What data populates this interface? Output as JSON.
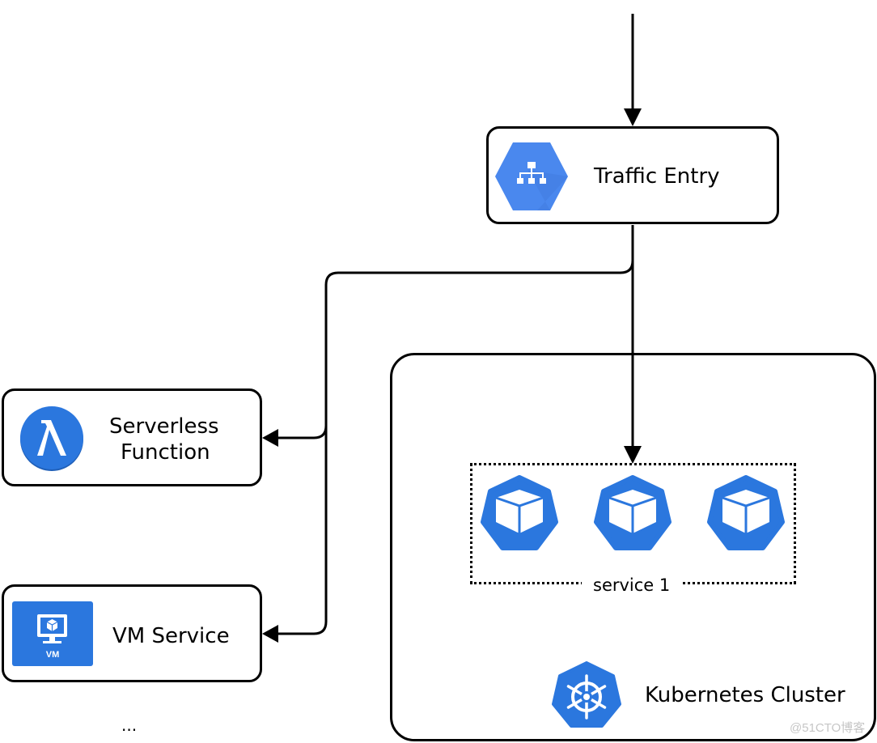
{
  "diagram": {
    "nodes": {
      "traffic_entry": {
        "label": "Traffic Entry",
        "icon": "load-balancer-icon"
      },
      "serverless": {
        "label_line1": "Serverless",
        "label_line2": "Function",
        "icon": "lambda-icon"
      },
      "vm_service": {
        "label": "VM Service",
        "icon": "vm-icon",
        "icon_caption": "VM"
      },
      "k8s_cluster": {
        "label": "Kubernetes Cluster",
        "icon": "kubernetes-helm-icon"
      },
      "service_group": {
        "label": "service 1",
        "pod_count": 3,
        "pod_icon": "kubernetes-pod-icon"
      }
    },
    "more_indicator": "...",
    "edges": [
      {
        "from": "external",
        "to": "traffic_entry"
      },
      {
        "from": "traffic_entry",
        "to": "serverless"
      },
      {
        "from": "traffic_entry",
        "to": "vm_service"
      },
      {
        "from": "traffic_entry",
        "to": "service_group"
      }
    ],
    "colors": {
      "icon_blue": "#2b77de",
      "gcp_blue": "#4a88ee",
      "stroke": "#000000"
    }
  },
  "watermark": "@51CTO博客"
}
